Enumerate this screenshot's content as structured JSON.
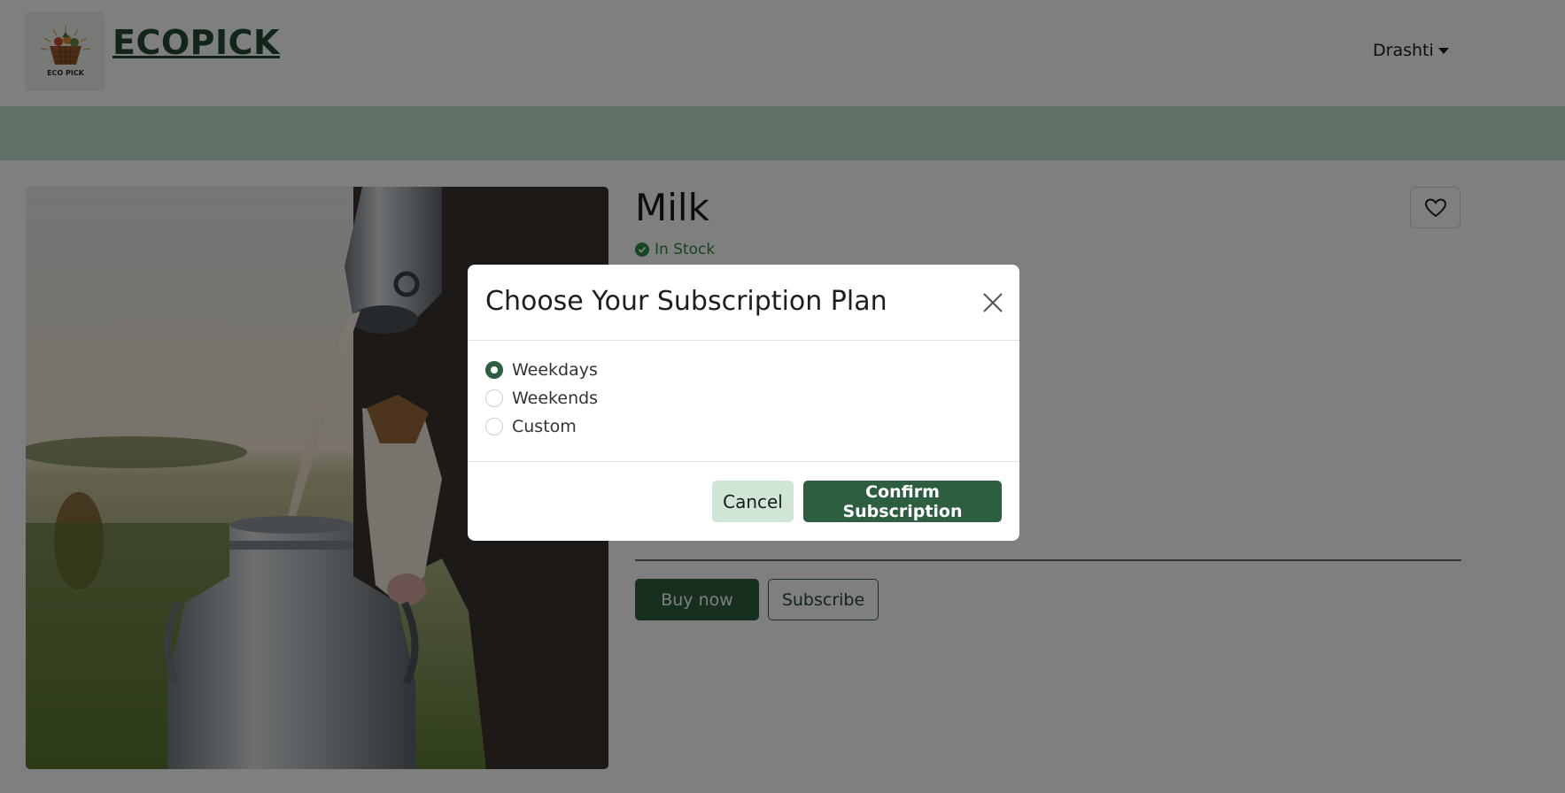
{
  "header": {
    "brand": "ECOPICK",
    "logo_text": "ECO PICK",
    "user_name": "Drashti"
  },
  "product": {
    "title": "Milk",
    "stock_status": "In Stock",
    "buy_label": "Buy now",
    "subscribe_label": "Subscribe"
  },
  "modal": {
    "title": "Choose Your Subscription Plan",
    "options": [
      {
        "label": "Weekdays",
        "selected": true
      },
      {
        "label": "Weekends",
        "selected": false
      },
      {
        "label": "Custom",
        "selected": false
      }
    ],
    "cancel_label": "Cancel",
    "confirm_label": "Confirm Subscription"
  },
  "colors": {
    "brand_green": "#2c5e3f",
    "band_green": "#c5e2cf",
    "stock_green": "#2f8a3e"
  },
  "icons": [
    "basket-logo-icon",
    "chevron-down-icon",
    "check-circle-icon",
    "heart-icon",
    "close-icon"
  ]
}
